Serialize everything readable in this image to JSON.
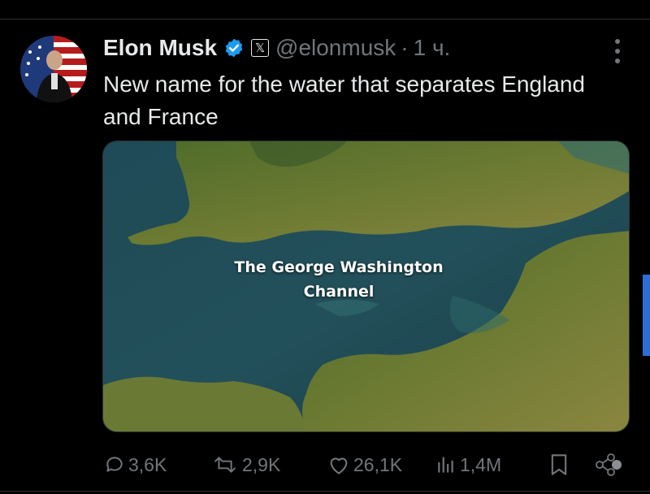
{
  "tweet": {
    "author_name": "Elon Musk",
    "handle": "@elonmusk",
    "separator": "·",
    "time": "1 ч.",
    "text": "New name for the water that separates England and France",
    "media": {
      "label_line1": "The George Washington",
      "label_line2": "Channel"
    }
  },
  "actions": {
    "replies": "3,6K",
    "reposts": "2,9K",
    "likes": "26,1K",
    "views": "1,4M"
  },
  "icons": {
    "verified": "verified-badge-icon",
    "affiliate": "x-logo-icon",
    "more": "more-vertical-icon",
    "reply": "reply-icon",
    "repost": "repost-icon",
    "like": "heart-icon",
    "views": "views-icon",
    "bookmark": "bookmark-icon",
    "share": "share-icon"
  },
  "colors": {
    "background": "#000000",
    "text": "#e7e9ea",
    "muted": "#71767b",
    "verified": "#1d9bf0"
  }
}
